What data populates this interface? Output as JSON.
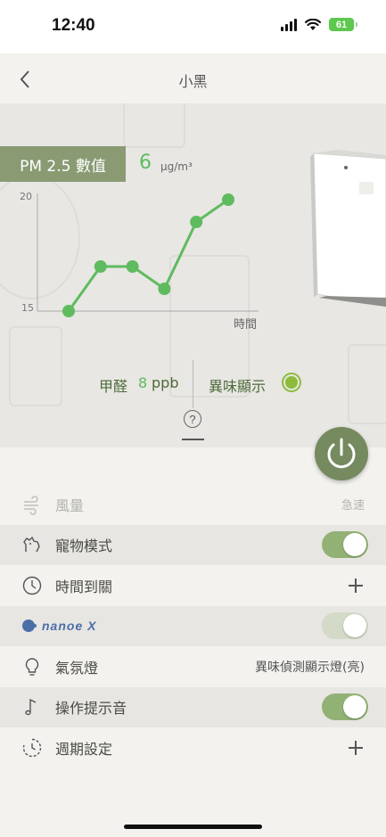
{
  "status_bar": {
    "time": "12:40",
    "battery": "61"
  },
  "header": {
    "title": "小黑"
  },
  "pm": {
    "label": "PM 2.5 數值",
    "value": "6",
    "unit": "µg/m³"
  },
  "chart_data": {
    "type": "line",
    "x": [
      1,
      2,
      3,
      4,
      5,
      6
    ],
    "values": [
      15,
      17,
      17,
      16,
      19,
      20
    ],
    "ylim": [
      15,
      20
    ],
    "yticks": [
      "20",
      "15"
    ],
    "xlabel": "時間",
    "color": "#5fbb5f"
  },
  "readouts": {
    "formaldehyde_label": "甲醛",
    "formaldehyde_value": "8",
    "formaldehyde_unit": "ppb",
    "odor_label": "異味顯示",
    "odor_color": "#8dbb3c"
  },
  "help": {
    "icon": "?"
  },
  "settings": [
    {
      "name": "airflow",
      "label": "風量",
      "value": "急速",
      "enabled": false
    },
    {
      "name": "pet-mode",
      "label": "寵物模式",
      "toggle": true
    },
    {
      "name": "off-timer",
      "label": "時間到關"
    },
    {
      "name": "nanoe",
      "label": "nanoe X",
      "toggle": true,
      "dim": true
    },
    {
      "name": "ambient-light",
      "label": "氣氛燈",
      "value": "異味偵測顯示燈(亮)"
    },
    {
      "name": "operation-sound",
      "label": "操作提示音",
      "toggle": true
    },
    {
      "name": "weekly-schedule",
      "label": "週期設定"
    }
  ],
  "colors": {
    "accent": "#8a9b74",
    "green": "#5fbb5f",
    "power": "#758a5f"
  }
}
